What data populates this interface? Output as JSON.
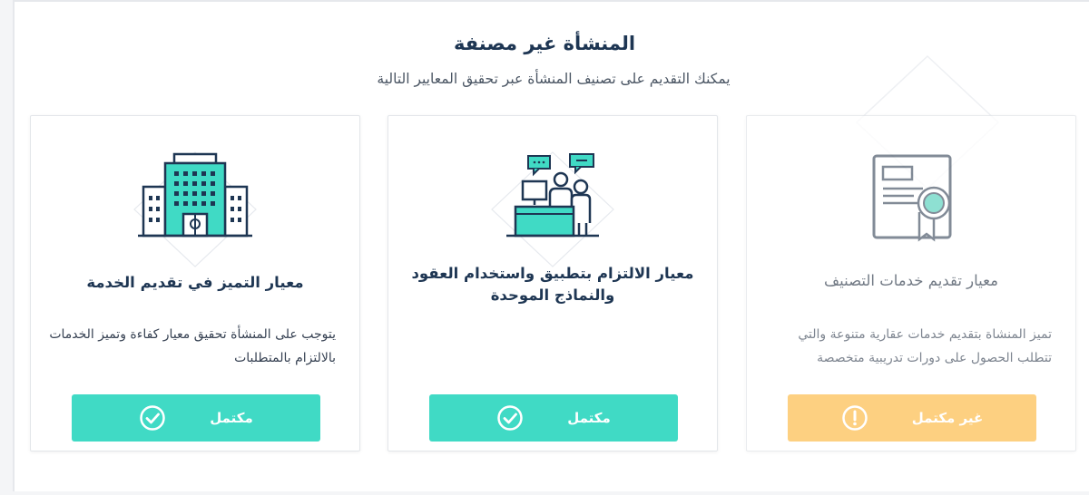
{
  "header": {
    "title": "المنشأة غير مصنفة",
    "subtitle": "يمكنك التقديم على تصنيف المنشأة عبر تحقيق المعايير التالية"
  },
  "colors": {
    "primary_text": "#1e3653",
    "complete": "#40dac5",
    "incomplete": "#fdc45e"
  },
  "cards": [
    {
      "title": "معيار تقديم خدمات التصنيف",
      "description": "تميز المنشاة بتقديم خدمات عقارية متنوعة والتي تتطلب الحصول على دورات تدريبية متخصصة",
      "status_label": "غير مكتمل",
      "status": "incomplete",
      "icon": "certificate-icon",
      "status_icon": "exclamation-circle-icon"
    },
    {
      "title": "معيار الالتزام بتطبيق واستخدام العقود والنماذج الموحدة",
      "description": "",
      "status_label": "مكتمل",
      "status": "complete",
      "icon": "meeting-icon",
      "status_icon": "check-circle-icon"
    },
    {
      "title": "معيار التميز في تقديم الخدمة",
      "description": "يتوجب على المنشأة تحقيق معيار كفاءة وتميز الخدمات بالالتزام بالمتطلبات",
      "status_label": "مكتمل",
      "status": "complete",
      "icon": "building-icon",
      "status_icon": "check-circle-icon"
    }
  ]
}
